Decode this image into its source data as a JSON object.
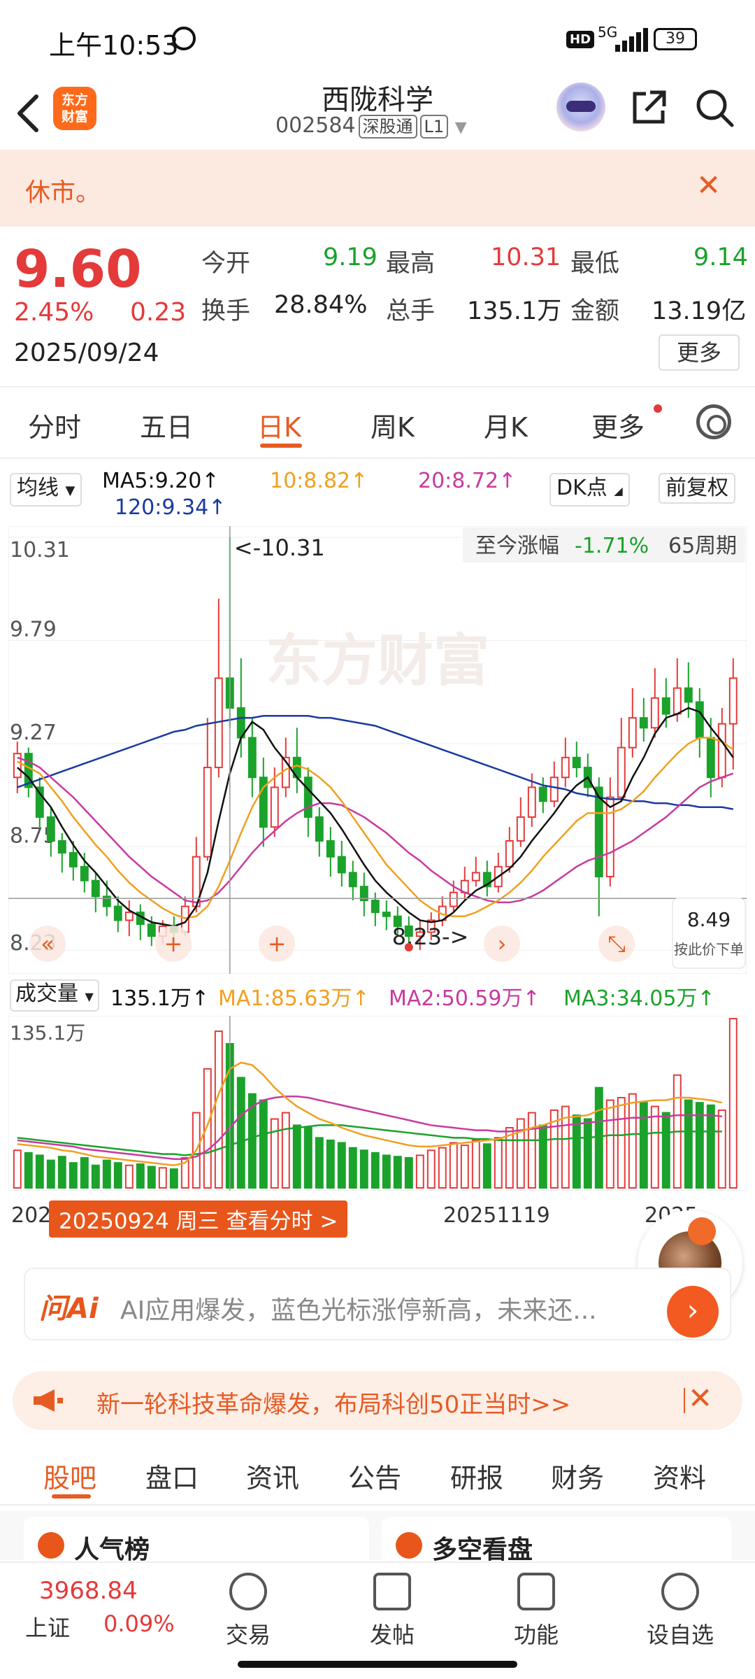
{
  "status": {
    "time": "上午10:53",
    "hd": "HD",
    "network": "5G",
    "battery": "39"
  },
  "header": {
    "logo_line1": "东方",
    "logo_line2": "财富",
    "title": "西陇科学",
    "code": "002584",
    "tag1": "深股通",
    "tag2": "L1"
  },
  "notice": {
    "text": "休市。",
    "close": "✕"
  },
  "quote": {
    "price": "9.60",
    "change_pct": "2.45%",
    "change": "0.23",
    "date": "2025/09/24",
    "open_label": "今开",
    "open": "9.19",
    "high_label": "最高",
    "high": "10.31",
    "low_label": "最低",
    "low": "9.14",
    "turnover_label": "换手",
    "turnover": "28.84%",
    "volume_label": "总手",
    "volume": "135.1万",
    "amount_label": "金额",
    "amount": "13.19亿",
    "more": "更多"
  },
  "tabs": [
    "分时",
    "五日",
    "日K",
    "周K",
    "月K",
    "更多"
  ],
  "ma_row": {
    "selector": "均线",
    "ma5": "MA5:9.20↑",
    "ma10": "10:8.82↑",
    "ma20": "20:8.72↑",
    "ma120": "120:9.34↑",
    "dk": "DK点",
    "adjust": "前复权"
  },
  "kchart": {
    "y_labels": [
      "10.31",
      "9.79",
      "9.27",
      "8.75",
      "8.23"
    ],
    "high_marker": "<-10.31",
    "low_marker": "8.23->",
    "watermark": "东方财富",
    "period_label": "至今涨幅",
    "period_value": "-1.71%",
    "period_count": "65周期",
    "cross_price": "8.49",
    "cross_action": "按此价下单",
    "colors": {
      "up": "#e43a3a",
      "down": "#1aa22b",
      "ma5": "#111111",
      "ma10": "#f0a020",
      "ma20": "#c83aa0",
      "ma120": "#1a3aa0"
    }
  },
  "volume": {
    "selector": "成交量",
    "value": "135.1万↑",
    "ma1": "MA1:85.63万↑",
    "ma2": "MA2:50.59万↑",
    "ma3": "MA3:34.05万↑",
    "y_label": "135.1万"
  },
  "xaxis": {
    "left": "202",
    "badge": "20250924 周三 查看分时 >",
    "mid": "20251119",
    "right": "2025"
  },
  "ai": {
    "logo": "问Ai",
    "text": "AI应用爆发，蓝色光标涨停新高，未来还..."
  },
  "banner": {
    "text": "新一轮科技革命爆发，布局科创50正当时>>"
  },
  "bottom_tabs": [
    "股吧",
    "盘口",
    "资讯",
    "公告",
    "研报",
    "财务",
    "资料"
  ],
  "cards": [
    "人气榜",
    "多空看盘"
  ],
  "bottom_nav": {
    "index_value": "3968.84",
    "index_name": "上证",
    "index_pct": "0.09%",
    "items": [
      "交易",
      "发帖",
      "功能",
      "设自选"
    ]
  },
  "chart_data": {
    "type": "candlestick",
    "price_range": [
      8.23,
      10.31
    ],
    "candles": [
      [
        9.1,
        9.22,
        9.28,
        9.02
      ],
      [
        9.22,
        9.05,
        9.25,
        9.0
      ],
      [
        9.05,
        8.9,
        9.1,
        8.85
      ],
      [
        8.9,
        8.78,
        8.95,
        8.7
      ],
      [
        8.78,
        8.72,
        8.82,
        8.62
      ],
      [
        8.72,
        8.65,
        8.78,
        8.58
      ],
      [
        8.65,
        8.58,
        8.72,
        8.52
      ],
      [
        8.58,
        8.5,
        8.62,
        8.42
      ],
      [
        8.5,
        8.45,
        8.58,
        8.4
      ],
      [
        8.45,
        8.38,
        8.5,
        8.32
      ],
      [
        8.38,
        8.42,
        8.48,
        8.3
      ],
      [
        8.42,
        8.36,
        8.46,
        8.28
      ],
      [
        8.36,
        8.3,
        8.4,
        8.25
      ],
      [
        8.3,
        8.35,
        8.38,
        8.26
      ],
      [
        8.35,
        8.32,
        8.4,
        8.27
      ],
      [
        8.32,
        8.45,
        8.5,
        8.3
      ],
      [
        8.45,
        8.7,
        8.8,
        8.42
      ],
      [
        8.7,
        9.15,
        9.4,
        8.68
      ],
      [
        9.15,
        9.6,
        10.0,
        9.1
      ],
      [
        9.6,
        9.45,
        10.31,
        9.35
      ],
      [
        9.45,
        9.3,
        9.7,
        9.2
      ],
      [
        9.3,
        9.1,
        9.4,
        9.0
      ],
      [
        9.1,
        8.85,
        9.2,
        8.75
      ],
      [
        8.85,
        9.05,
        9.15,
        8.8
      ],
      [
        9.05,
        9.2,
        9.3,
        9.0
      ],
      [
        9.2,
        9.1,
        9.35,
        9.02
      ],
      [
        9.1,
        8.9,
        9.15,
        8.8
      ],
      [
        8.9,
        8.78,
        8.95,
        8.7
      ],
      [
        8.78,
        8.7,
        8.85,
        8.6
      ],
      [
        8.7,
        8.62,
        8.78,
        8.55
      ],
      [
        8.62,
        8.55,
        8.68,
        8.48
      ],
      [
        8.55,
        8.48,
        8.62,
        8.4
      ],
      [
        8.48,
        8.42,
        8.52,
        8.35
      ],
      [
        8.42,
        8.4,
        8.48,
        8.33
      ],
      [
        8.4,
        8.35,
        8.45,
        8.3
      ],
      [
        8.35,
        8.3,
        8.4,
        8.24
      ],
      [
        8.3,
        8.32,
        8.38,
        8.23
      ],
      [
        8.32,
        8.38,
        8.42,
        8.28
      ],
      [
        8.38,
        8.45,
        8.5,
        8.35
      ],
      [
        8.45,
        8.52,
        8.58,
        8.42
      ],
      [
        8.52,
        8.58,
        8.65,
        8.48
      ],
      [
        8.58,
        8.62,
        8.7,
        8.55
      ],
      [
        8.62,
        8.55,
        8.68,
        8.5
      ],
      [
        8.55,
        8.65,
        8.72,
        8.52
      ],
      [
        8.65,
        8.78,
        8.85,
        8.62
      ],
      [
        8.78,
        8.9,
        9.0,
        8.75
      ],
      [
        8.9,
        9.05,
        9.12,
        8.85
      ],
      [
        9.05,
        8.98,
        9.1,
        8.92
      ],
      [
        8.98,
        9.1,
        9.18,
        8.95
      ],
      [
        9.1,
        9.2,
        9.3,
        9.05
      ],
      [
        9.2,
        9.15,
        9.28,
        9.1
      ],
      [
        9.15,
        9.05,
        9.22,
        9.0
      ],
      [
        9.05,
        8.6,
        9.1,
        8.4
      ],
      [
        8.6,
        9.0,
        9.1,
        8.55
      ],
      [
        9.0,
        9.25,
        9.4,
        8.98
      ],
      [
        9.25,
        9.4,
        9.55,
        9.2
      ],
      [
        9.4,
        9.35,
        9.5,
        9.28
      ],
      [
        9.35,
        9.5,
        9.65,
        9.3
      ],
      [
        9.5,
        9.42,
        9.6,
        9.35
      ],
      [
        9.42,
        9.55,
        9.7,
        9.38
      ],
      [
        9.55,
        9.48,
        9.68,
        9.4
      ],
      [
        9.48,
        9.3,
        9.55,
        9.2
      ],
      [
        9.3,
        9.1,
        9.4,
        9.0
      ],
      [
        9.1,
        9.37,
        9.45,
        9.05
      ],
      [
        9.37,
        9.6,
        9.7,
        9.14
      ]
    ],
    "ma5": [
      9.15,
      9.1,
      9.02,
      8.95,
      8.85,
      8.76,
      8.68,
      8.62,
      8.55,
      8.48,
      8.43,
      8.4,
      8.37,
      8.36,
      8.35,
      8.37,
      8.45,
      8.62,
      8.88,
      9.12,
      9.3,
      9.38,
      9.34,
      9.25,
      9.18,
      9.1,
      9.04,
      8.98,
      8.92,
      8.84,
      8.75,
      8.66,
      8.58,
      8.52,
      8.47,
      8.42,
      8.38,
      8.37,
      8.38,
      8.42,
      8.48,
      8.53,
      8.56,
      8.6,
      8.64,
      8.7,
      8.78,
      8.85,
      8.92,
      9.0,
      9.06,
      9.1,
      9.0,
      8.95,
      8.98,
      9.1,
      9.2,
      9.32,
      9.4,
      9.42,
      9.45,
      9.43,
      9.35,
      9.28,
      9.2
    ],
    "ma10": [
      9.18,
      9.15,
      9.12,
      9.05,
      8.98,
      8.9,
      8.83,
      8.76,
      8.7,
      8.63,
      8.57,
      8.52,
      8.48,
      8.44,
      8.41,
      8.39,
      8.4,
      8.45,
      8.55,
      8.68,
      8.82,
      8.95,
      9.05,
      9.1,
      9.14,
      9.16,
      9.14,
      9.1,
      9.05,
      8.98,
      8.9,
      8.82,
      8.74,
      8.66,
      8.6,
      8.54,
      8.48,
      8.44,
      8.41,
      8.4,
      8.4,
      8.42,
      8.45,
      8.48,
      8.52,
      8.57,
      8.63,
      8.7,
      8.76,
      8.82,
      8.88,
      8.92,
      8.92,
      8.92,
      8.94,
      8.98,
      9.03,
      9.1,
      9.16,
      9.22,
      9.27,
      9.3,
      9.3,
      9.28,
      9.24
    ],
    "ma20": [
      9.2,
      9.18,
      9.15,
      9.1,
      9.05,
      9.0,
      8.94,
      8.88,
      8.82,
      8.76,
      8.7,
      8.65,
      8.6,
      8.56,
      8.52,
      8.48,
      8.47,
      8.48,
      8.52,
      8.58,
      8.65,
      8.72,
      8.78,
      8.83,
      8.88,
      8.92,
      8.95,
      8.97,
      8.97,
      8.96,
      8.93,
      8.9,
      8.86,
      8.82,
      8.77,
      8.72,
      8.68,
      8.63,
      8.59,
      8.55,
      8.52,
      8.5,
      8.48,
      8.47,
      8.47,
      8.48,
      8.5,
      8.53,
      8.57,
      8.61,
      8.65,
      8.68,
      8.7,
      8.72,
      8.75,
      8.78,
      8.82,
      8.86,
      8.9,
      8.95,
      9.0,
      9.05,
      9.08,
      9.1,
      9.12
    ],
    "ma120": [
      9.05,
      9.07,
      9.09,
      9.11,
      9.13,
      9.15,
      9.17,
      9.19,
      9.21,
      9.23,
      9.25,
      9.27,
      9.29,
      9.31,
      9.33,
      9.34,
      9.36,
      9.37,
      9.38,
      9.39,
      9.4,
      9.4,
      9.41,
      9.41,
      9.41,
      9.41,
      9.41,
      9.4,
      9.4,
      9.39,
      9.38,
      9.37,
      9.36,
      9.34,
      9.32,
      9.3,
      9.28,
      9.26,
      9.24,
      9.22,
      9.2,
      9.18,
      9.16,
      9.14,
      9.12,
      9.1,
      9.08,
      9.06,
      9.05,
      9.04,
      9.02,
      9.01,
      9.0,
      8.99,
      8.99,
      8.98,
      8.98,
      8.97,
      8.97,
      8.96,
      8.96,
      8.95,
      8.95,
      8.95,
      8.94
    ],
    "volumes": [
      30,
      28,
      26,
      22,
      25,
      20,
      24,
      18,
      22,
      20,
      18,
      19,
      17,
      16,
      15,
      24,
      60,
      95,
      125,
      115,
      88,
      75,
      70,
      55,
      60,
      50,
      48,
      40,
      38,
      36,
      32,
      30,
      28,
      26,
      25,
      24,
      26,
      30,
      32,
      36,
      34,
      38,
      35,
      40,
      48,
      55,
      60,
      50,
      62,
      65,
      58,
      55,
      80,
      70,
      72,
      75,
      68,
      65,
      60,
      90,
      70,
      68,
      66,
      62,
      135.1
    ],
    "vol_ma1": [
      35,
      34,
      33,
      32,
      30,
      29,
      27,
      25,
      24,
      23,
      22,
      21,
      20,
      19,
      18,
      20,
      30,
      50,
      75,
      95,
      100,
      98,
      90,
      80,
      72,
      65,
      60,
      55,
      52,
      48,
      45,
      42,
      40,
      38,
      36,
      34,
      33,
      33,
      34,
      35,
      36,
      37,
      38,
      39,
      42,
      45,
      48,
      50,
      53,
      56,
      57,
      58,
      62,
      64,
      66,
      68,
      69,
      70,
      70,
      72,
      72,
      71,
      70,
      68,
      85.63
    ],
    "vol_ma2": [
      38,
      37,
      36,
      35,
      34,
      33,
      31,
      30,
      29,
      28,
      27,
      26,
      25,
      24,
      23,
      23,
      25,
      30,
      38,
      48,
      58,
      65,
      70,
      72,
      73,
      73,
      72,
      70,
      68,
      66,
      64,
      62,
      60,
      58,
      56,
      54,
      52,
      50,
      49,
      48,
      47,
      46,
      46,
      45,
      45,
      46,
      47,
      48,
      49,
      50,
      51,
      52,
      53,
      54,
      55,
      56,
      56,
      57,
      57,
      58,
      58,
      58,
      58,
      57,
      50.59
    ],
    "vol_ma3": [
      40,
      39,
      38,
      37,
      36,
      35,
      34,
      33,
      32,
      31,
      30,
      29,
      28,
      27,
      27,
      26,
      27,
      28,
      31,
      34,
      37,
      40,
      43,
      45,
      47,
      48,
      49,
      50,
      50,
      50,
      49,
      48,
      47,
      46,
      45,
      44,
      43,
      42,
      41,
      40,
      40,
      39,
      39,
      38,
      38,
      38,
      38,
      38,
      39,
      39,
      40,
      40,
      41,
      42,
      42,
      43,
      43,
      44,
      44,
      45,
      45,
      45,
      45,
      45,
      34.05
    ]
  }
}
